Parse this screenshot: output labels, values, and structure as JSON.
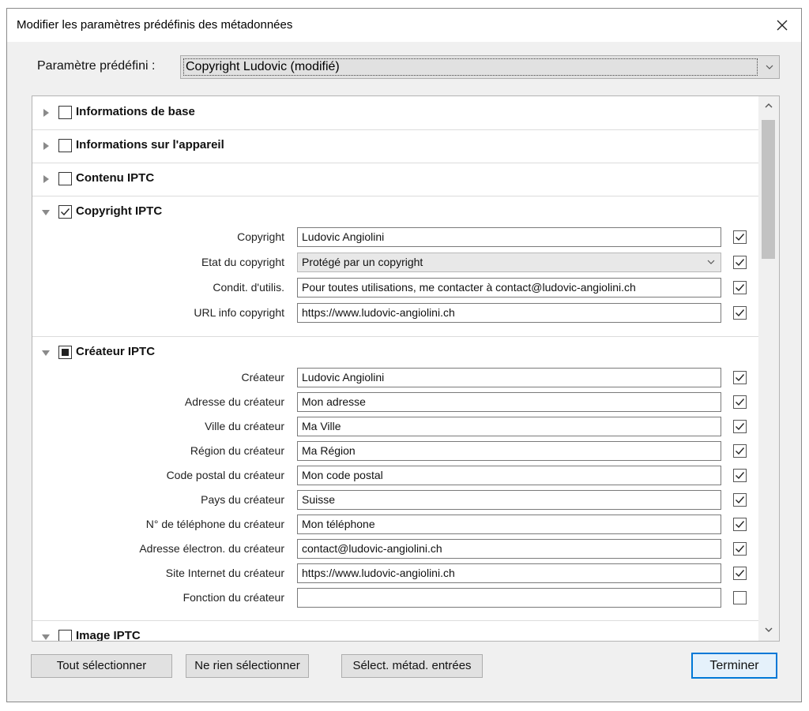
{
  "dialog": {
    "title": "Modifier les paramètres prédéfinis des métadonnées",
    "close_icon": "close-icon"
  },
  "preset": {
    "label": "Paramètre prédéfini :",
    "value": "Copyright Ludovic (modifié)"
  },
  "sections": [
    {
      "title": "Informations de base",
      "expanded": false,
      "state": "unchecked"
    },
    {
      "title": "Informations sur l'appareil",
      "expanded": false,
      "state": "unchecked"
    },
    {
      "title": "Contenu IPTC",
      "expanded": false,
      "state": "unchecked"
    },
    {
      "title": "Copyright IPTC",
      "expanded": true,
      "state": "checked",
      "fields": [
        {
          "label": "Copyright",
          "value": "Ludovic Angiolini",
          "type": "text",
          "checked": true
        },
        {
          "label": "Etat du copyright",
          "value": "Protégé par un copyright",
          "type": "select",
          "checked": true
        },
        {
          "label": "Condit. d'utilis.",
          "value": "Pour toutes utilisations, me contacter à contact@ludovic-angiolini.ch",
          "type": "text",
          "checked": true
        },
        {
          "label": "URL info copyright",
          "value": "https://www.ludovic-angiolini.ch",
          "type": "text",
          "checked": true
        }
      ]
    },
    {
      "title": "Créateur IPTC",
      "expanded": true,
      "state": "partial",
      "fields": [
        {
          "label": "Créateur",
          "value": "Ludovic Angiolini",
          "checked": true
        },
        {
          "label": "Adresse du créateur",
          "value": "Mon adresse",
          "checked": true
        },
        {
          "label": "Ville du créateur",
          "value": "Ma Ville",
          "checked": true
        },
        {
          "label": "Région du créateur",
          "value": "Ma Région",
          "checked": true
        },
        {
          "label": "Code postal du créateur",
          "value": "Mon code postal",
          "checked": true
        },
        {
          "label": "Pays du créateur",
          "value": "Suisse",
          "checked": true
        },
        {
          "label": "N° de téléphone du créateur",
          "value": "Mon téléphone",
          "checked": true
        },
        {
          "label": "Adresse électron. du créateur",
          "value": "contact@ludovic-angiolini.ch",
          "checked": true
        },
        {
          "label": "Site Internet du créateur",
          "value": "https://www.ludovic-angiolini.ch",
          "checked": true
        },
        {
          "label": "Fonction du créateur",
          "value": "",
          "checked": false
        }
      ]
    },
    {
      "title": "Image IPTC",
      "expanded": true,
      "state": "unchecked"
    }
  ],
  "buttons": {
    "select_all": "Tout sélectionner",
    "select_none": "Ne rien sélectionner",
    "select_entered": "Sélect. métad. entrées",
    "done": "Terminer"
  },
  "colors": {
    "accent": "#0078d7",
    "dialog_bg": "#f0f0f0"
  }
}
